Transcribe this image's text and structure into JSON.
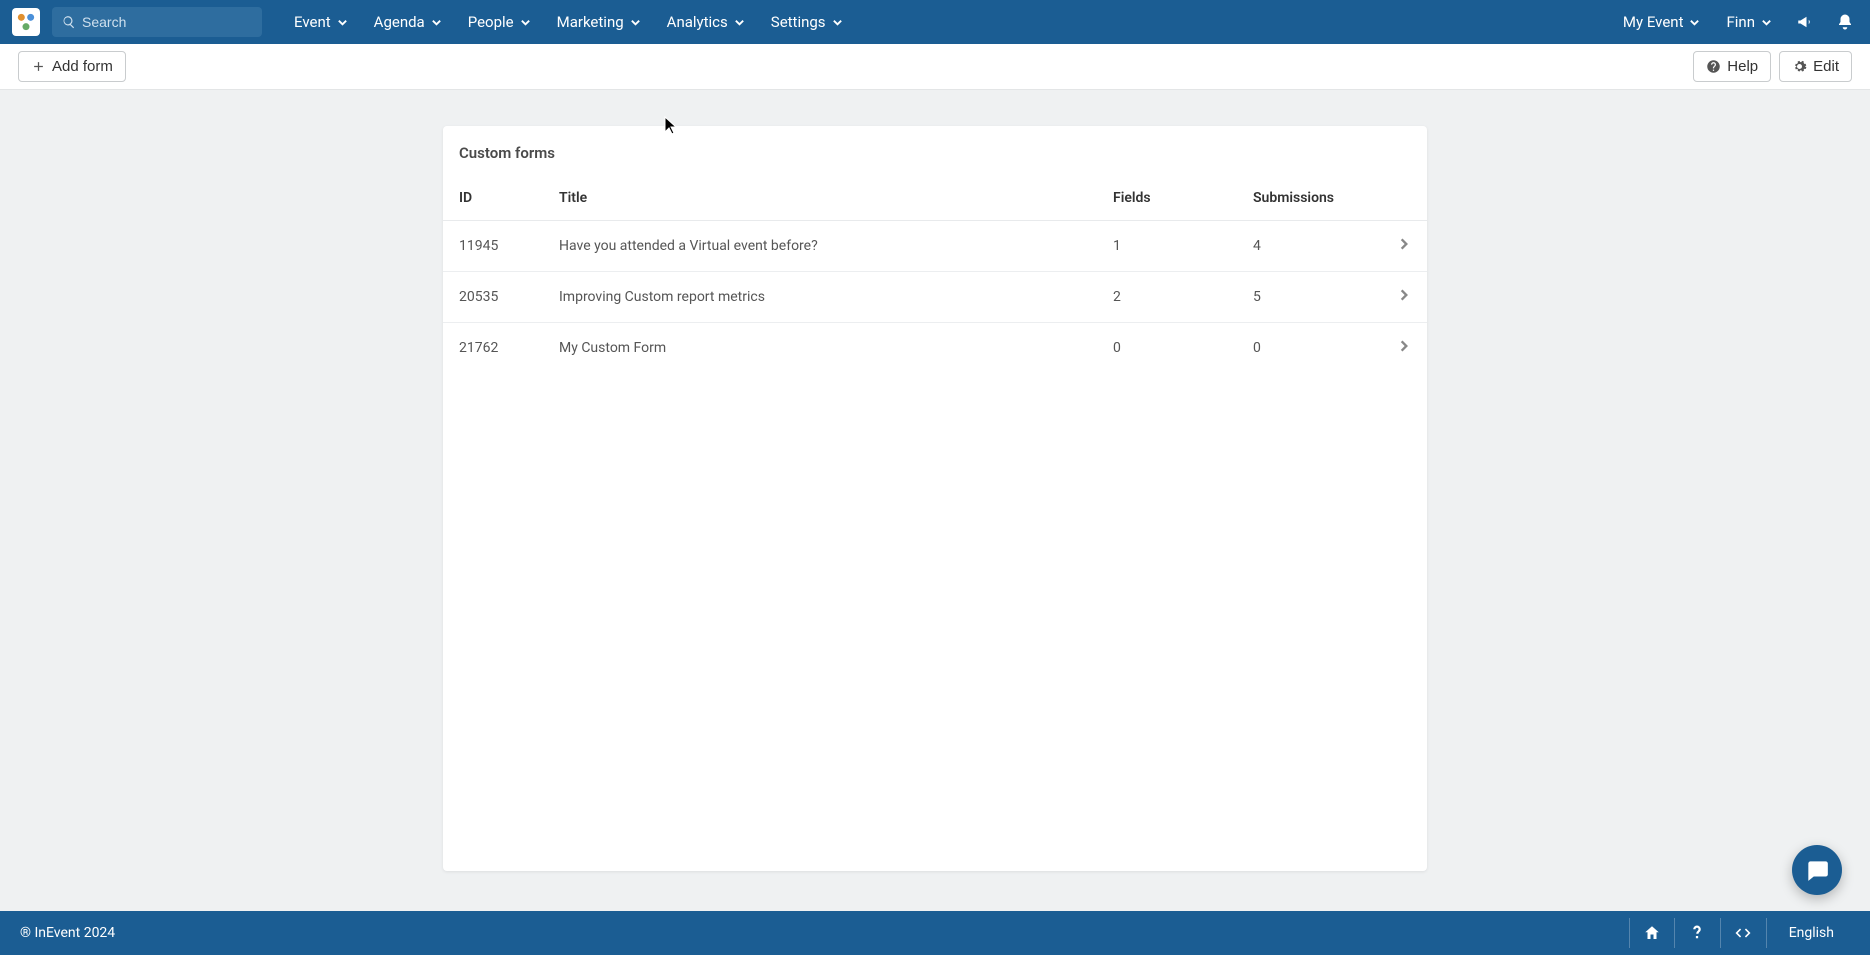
{
  "search": {
    "placeholder": "Search"
  },
  "nav": {
    "left": [
      "Event",
      "Agenda",
      "People",
      "Marketing",
      "Analytics",
      "Settings"
    ],
    "right_event": "My Event",
    "right_user": "Finn"
  },
  "toolbar": {
    "add_label": "Add form",
    "help_label": "Help",
    "edit_label": "Edit"
  },
  "card": {
    "title": "Custom forms",
    "columns": {
      "id": "ID",
      "title": "Title",
      "fields": "Fields",
      "subs": "Submissions"
    },
    "rows": [
      {
        "id": "11945",
        "title": "Have you attended a Virtual event before?",
        "fields": "1",
        "subs": "4"
      },
      {
        "id": "20535",
        "title": "Improving Custom report metrics",
        "fields": "2",
        "subs": "5"
      },
      {
        "id": "21762",
        "title": "My Custom Form",
        "fields": "0",
        "subs": "0"
      }
    ]
  },
  "footer": {
    "copyright": "® InEvent 2024",
    "lang": "English"
  }
}
